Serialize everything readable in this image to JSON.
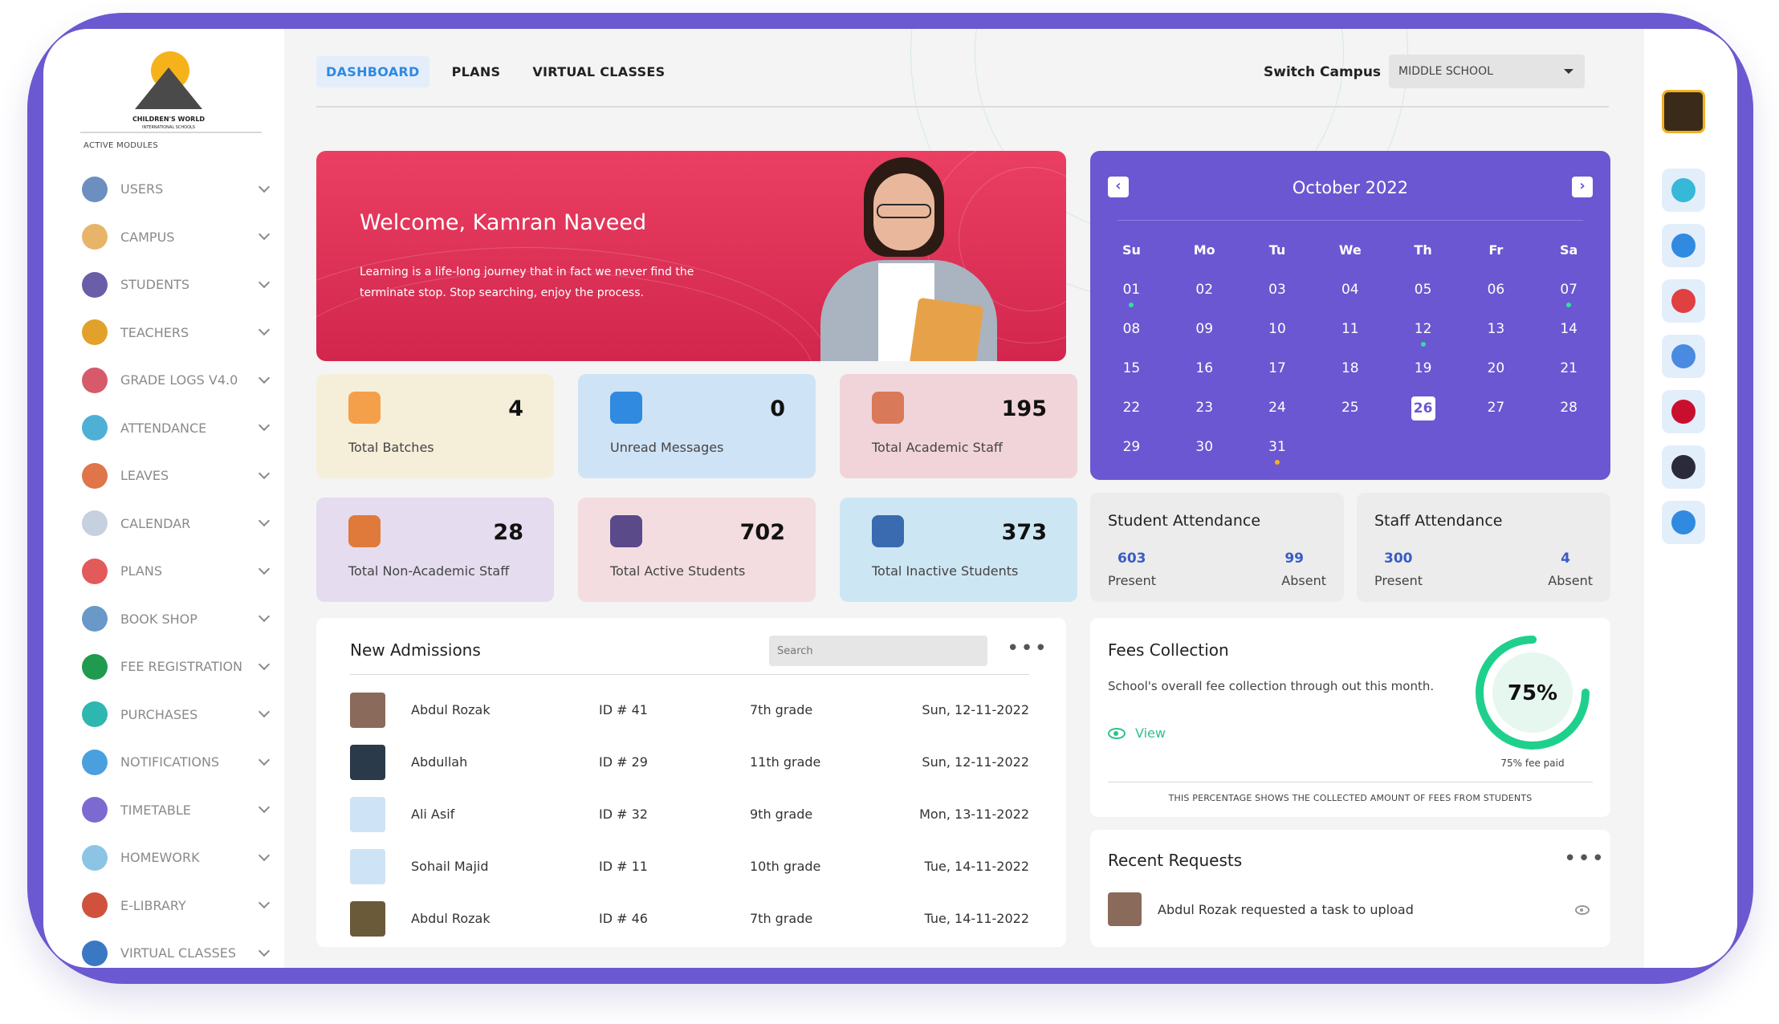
{
  "sidebar": {
    "logo_text": "CHILDREN'S WORLD",
    "logo_subtext": "INTERNATIONAL SCHOOLS",
    "modules_title": "ACTIVE MODULES",
    "items": [
      {
        "label": "USERS",
        "icon": "users-icon",
        "color": "#6d8fbf"
      },
      {
        "label": "CAMPUS",
        "icon": "campus-icon",
        "color": "#e8b46a"
      },
      {
        "label": "STUDENTS",
        "icon": "students-icon",
        "color": "#6a5ea8"
      },
      {
        "label": "TEACHERS",
        "icon": "teachers-icon",
        "color": "#e2a12a"
      },
      {
        "label": "GRADE LOGS V4.0",
        "icon": "grade-logs-icon",
        "color": "#d65a6a"
      },
      {
        "label": "ATTENDANCE",
        "icon": "attendance-icon",
        "color": "#4fb0d6"
      },
      {
        "label": "LEAVES",
        "icon": "leaves-icon",
        "color": "#e0744a"
      },
      {
        "label": "CALENDAR",
        "icon": "calendar-icon",
        "color": "#c6d0de"
      },
      {
        "label": "PLANS",
        "icon": "plans-icon",
        "color": "#e35a5a"
      },
      {
        "label": "BOOK SHOP",
        "icon": "book-shop-icon",
        "color": "#6a98c8"
      },
      {
        "label": "FEE REGISTRATION",
        "icon": "fee-registration-icon",
        "color": "#1f9a4e"
      },
      {
        "label": "PURCHASES",
        "icon": "purchases-icon",
        "color": "#2eb6b0"
      },
      {
        "label": "NOTIFICATIONS",
        "icon": "notifications-icon",
        "color": "#4aa0de"
      },
      {
        "label": "TIMETABLE",
        "icon": "timetable-icon",
        "color": "#7d6ad0"
      },
      {
        "label": "HOMEWORK",
        "icon": "homework-icon",
        "color": "#8cc4e6"
      },
      {
        "label": "E-LIBRARY",
        "icon": "e-library-icon",
        "color": "#d0523c"
      },
      {
        "label": "VIRTUAL CLASSES",
        "icon": "virtual-classes-icon",
        "color": "#3a78c4"
      }
    ]
  },
  "topnav": {
    "tabs": [
      "DASHBOARD",
      "PLANS",
      "VIRTUAL CLASSES"
    ],
    "active_tab": "DASHBOARD",
    "switch_label": "Switch Campus",
    "switch_value": "MIDDLE SCHOOL"
  },
  "welcome": {
    "title": "Welcome, Kamran Naveed",
    "message": "Learning is a life-long journey that in fact we never find the terminate stop. Stop searching, enjoy the process."
  },
  "stats": [
    {
      "value": "4",
      "label": "Total Batches",
      "bg": "#f5eed9",
      "icon": "batches-icon",
      "icon_color": "#f4a04a"
    },
    {
      "value": "0",
      "label": "Unread Messages",
      "bg": "#cfe3f6",
      "icon": "messages-icon",
      "icon_color": "#2f8ae0"
    },
    {
      "value": "195",
      "label": "Total Academic Staff",
      "bg": "#f1d4da",
      "icon": "academic-staff-icon",
      "icon_color": "#d87a5a"
    },
    {
      "value": "28",
      "label": "Total Non-Academic Staff",
      "bg": "#e5dcef",
      "icon": "non-academic-staff-icon",
      "icon_color": "#e07a3a"
    },
    {
      "value": "702",
      "label": "Total Active Students",
      "bg": "#f3dde1",
      "icon": "active-students-icon",
      "icon_color": "#5a4a8a"
    },
    {
      "value": "373",
      "label": "Total Inactive Students",
      "bg": "#cde6f3",
      "icon": "inactive-students-icon",
      "icon_color": "#3a6ab0"
    }
  ],
  "calendar": {
    "title": "October 2022",
    "weekdays": [
      "Su",
      "Mo",
      "Tu",
      "We",
      "Th",
      "Fr",
      "Sa"
    ],
    "weeks": [
      [
        "01",
        "02",
        "03",
        "04",
        "05",
        "06",
        "07"
      ],
      [
        "08",
        "09",
        "10",
        "11",
        "12",
        "13",
        "14"
      ],
      [
        "15",
        "16",
        "17",
        "18",
        "19",
        "20",
        "21"
      ],
      [
        "22",
        "23",
        "24",
        "25",
        "26",
        "27",
        "28"
      ],
      [
        "29",
        "30",
        "31",
        "",
        "",
        "",
        ""
      ]
    ],
    "today": "26",
    "dots": {
      "01": "#2ee0a0",
      "07": "#2ee0a0",
      "12": "#2ee0a0",
      "31": "#f5b21a"
    }
  },
  "student_attendance": {
    "title": "Student Attendance",
    "present": "603",
    "absent": "99",
    "present_label": "Present",
    "absent_label": "Absent"
  },
  "staff_attendance": {
    "title": "Staff Attendance",
    "present": "300",
    "absent": "4",
    "present_label": "Present",
    "absent_label": "Absent"
  },
  "admissions": {
    "title": "New Admissions",
    "search_placeholder": "Search",
    "rows": [
      {
        "name": "Abdul Rozak",
        "id": "ID # 41",
        "grade": "7th grade",
        "date": "Sun, 12-11-2022",
        "avatar_color": "#8a6a5a"
      },
      {
        "name": "Abdullah",
        "id": "ID # 29",
        "grade": "11th grade",
        "date": "Sun, 12-11-2022",
        "avatar_color": "#2a3a4a"
      },
      {
        "name": "Ali Asif",
        "id": "ID # 32",
        "grade": "9th grade",
        "date": "Mon, 13-11-2022",
        "avatar_color": "#cfe3f6"
      },
      {
        "name": "Sohail Majid",
        "id": "ID # 11",
        "grade": "10th grade",
        "date": "Tue, 14-11-2022",
        "avatar_color": "#cfe3f6"
      },
      {
        "name": "Abdul Rozak",
        "id": "ID # 46",
        "grade": "7th grade",
        "date": "Tue, 14-11-2022",
        "avatar_color": "#6a5a3a"
      }
    ]
  },
  "fees": {
    "title": "Fees Collection",
    "description": "School's overall fee collection through out this month.",
    "view_label": "View",
    "percent": 75,
    "percent_label": "75%",
    "paid_label": "75% fee paid",
    "note": "THIS PERCENTAGE SHOWS THE COLLECTED AMOUNT OF FEES FROM STUDENTS"
  },
  "requests": {
    "title": "Recent Requests",
    "items": [
      {
        "text": "Abdul Rozak requested a task to upload"
      }
    ]
  },
  "rail": [
    {
      "icon": "chat-icon",
      "color": "#36b8d8"
    },
    {
      "icon": "messenger-icon",
      "color": "#2f8ae0"
    },
    {
      "icon": "news-icon",
      "color": "#e04040"
    },
    {
      "icon": "settings-icon",
      "color": "#4a8ae0"
    },
    {
      "icon": "language-flag-icon",
      "color": "#c8102e"
    },
    {
      "icon": "vr-icon",
      "color": "#2a2a3a"
    },
    {
      "icon": "logout-icon",
      "color": "#2f8ae0"
    }
  ],
  "colors": {
    "accent": "#6b57d1",
    "welcome": "#e03a5e",
    "success": "#2ec28a",
    "link": "#2f8ae0"
  }
}
